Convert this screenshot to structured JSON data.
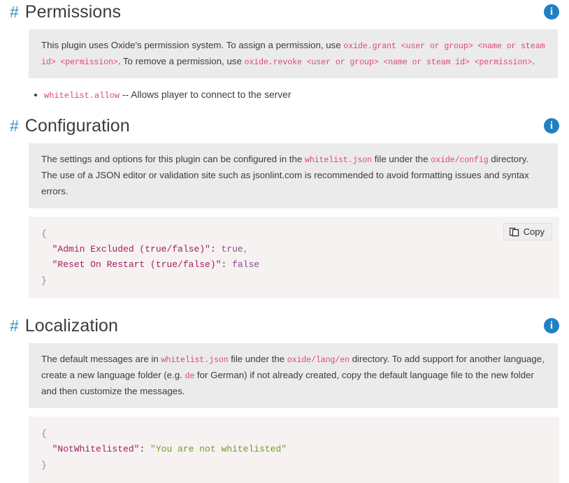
{
  "theme": {
    "hash_color": "#3b93c4",
    "heading_color": "#3c3c3c",
    "inline_code_color": "#e0457b",
    "note_bg": "#ebebeb",
    "code_bg": "#f6f2f2",
    "badge_bg": "#2180c4",
    "json_key_color": "#a11d5e",
    "json_bool_color": "#8c4a8c",
    "json_string_color": "#6f9b2e"
  },
  "sections": [
    {
      "hash": "#",
      "title": "Permissions",
      "info_icon": "info-icon",
      "info_glyph": "i",
      "note": {
        "p1_a": "This plugin uses Oxide's permission system. To assign a permission, use ",
        "code1": "oxide.grant <user or group> <name or steam id> <permission>",
        "p1_b": ". To remove a permission, use ",
        "code2": "oxide.revoke <user or group> <name or steam id> <permission>",
        "p1_c": "."
      },
      "bullets": [
        {
          "name": "whitelist.allow",
          "desc": " -- Allows player to connect to the server"
        }
      ]
    },
    {
      "hash": "#",
      "title": "Configuration",
      "info_icon": "info-icon",
      "info_glyph": "i",
      "note": {
        "p1_a": "The settings and options for this plugin can be configured in the ",
        "code1": "whitelist.json",
        "p1_b": " file under the ",
        "code2": "oxide/config",
        "p1_c": " directory. The use of a JSON editor or validation site such as jsonlint.com is recommended to avoid formatting issues and syntax errors."
      },
      "code": {
        "copy_label": "Copy",
        "copy_icon": "copy-icon",
        "lines": [
          {
            "open": "{"
          },
          {
            "indent": "  ",
            "key": "\"Admin Excluded (true/false)\"",
            "colon": ": ",
            "bool": "true",
            "trail": ","
          },
          {
            "indent": "  ",
            "key": "\"Reset On Restart (true/false)\"",
            "colon": ": ",
            "bool": "false",
            "trail": ""
          },
          {
            "close": "}"
          }
        ]
      }
    },
    {
      "hash": "#",
      "title": "Localization",
      "info_icon": "info-icon",
      "info_glyph": "i",
      "note": {
        "p1_a": "The default messages are in ",
        "code1": "whitelist.json",
        "p1_b": " file under the ",
        "code2": "oxide/lang/en",
        "p1_c": " directory. To add support for another language, create a new language folder (e.g. ",
        "code3": "de",
        "p1_d": " for German) if not already created, copy the default language file to the new folder and then customize the messages."
      },
      "code": {
        "lines": [
          {
            "open": "{"
          },
          {
            "indent": "  ",
            "key": "\"NotWhitelisted\"",
            "colon": ": ",
            "string": "\"You are not whitelisted\"",
            "trail": ""
          },
          {
            "close": "}"
          }
        ]
      }
    }
  ]
}
